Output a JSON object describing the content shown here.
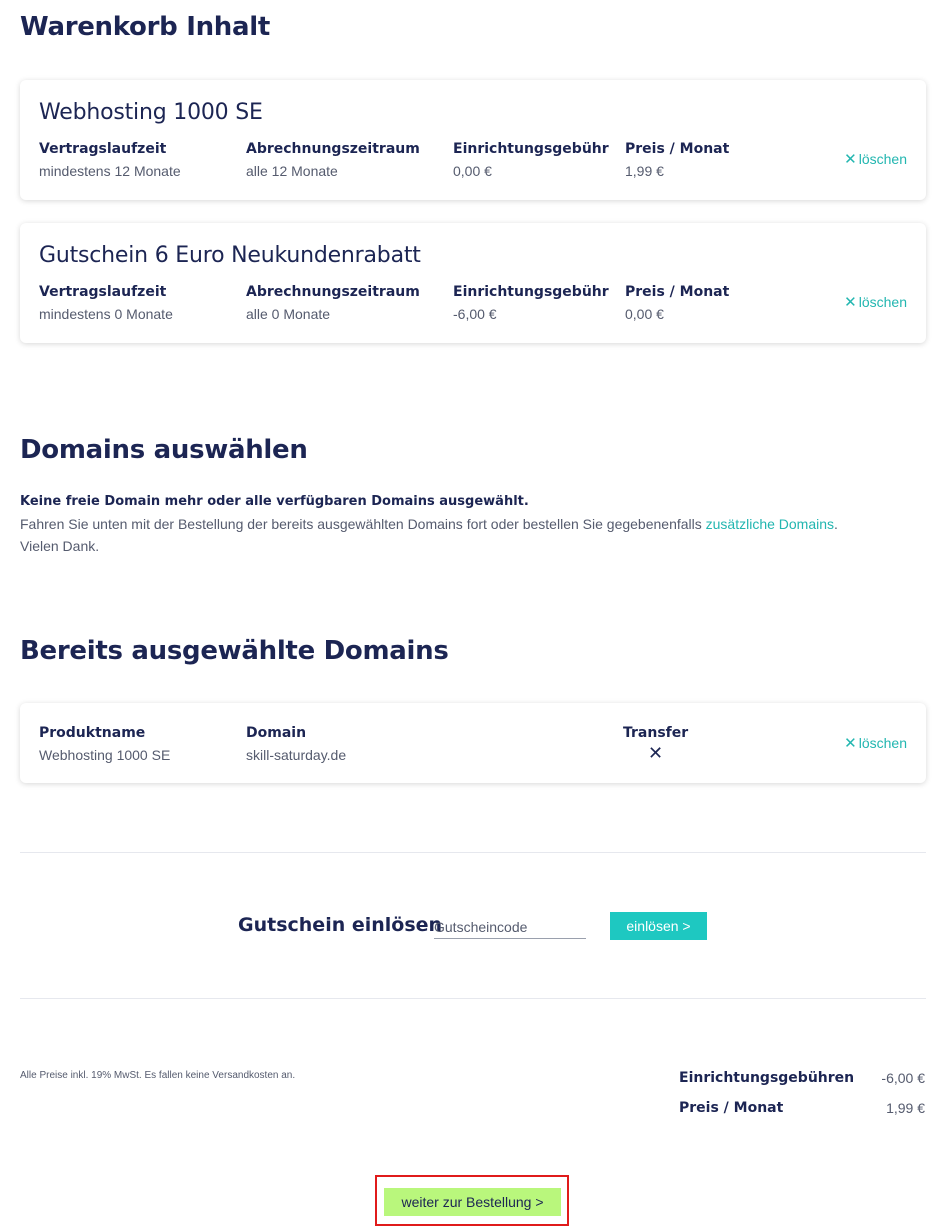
{
  "cart": {
    "title": "Warenkorb Inhalt",
    "items": [
      {
        "name": "Webhosting 1000 SE",
        "columns": [
          {
            "label": "Vertragslaufzeit",
            "value": "mindestens 12 Monate"
          },
          {
            "label": "Abrechnungszeitraum",
            "value": "alle 12 Monate"
          },
          {
            "label": "Einrichtungsgebühr",
            "value": "0,00 €"
          },
          {
            "label": "Preis / Monat",
            "value": "1,99 €"
          }
        ],
        "delete_label": "löschen"
      },
      {
        "name": "Gutschein 6 Euro Neukundenrabatt",
        "columns": [
          {
            "label": "Vertragslaufzeit",
            "value": "mindestens 0 Monate"
          },
          {
            "label": "Abrechnungszeitraum",
            "value": "alle 0 Monate"
          },
          {
            "label": "Einrichtungsgebühr",
            "value": "-6,00 €"
          },
          {
            "label": "Preis / Monat",
            "value": "0,00 €"
          }
        ],
        "delete_label": "löschen"
      }
    ]
  },
  "domains": {
    "title": "Domains auswählen",
    "notice_bold": "Keine freie Domain mehr oder alle verfügbaren Domains ausgewählt.",
    "notice_line2_prefix": "Fahren Sie unten mit der Bestellung der bereits ausgewählten Domains fort oder bestellen Sie gegebenenfalls ",
    "notice_link": "zusätzliche Domains",
    "notice_line2_suffix": ".",
    "notice_line3": "Vielen Dank."
  },
  "selected_domains": {
    "title": "Bereits ausgewählte Domains",
    "row": {
      "product_label": "Produktname",
      "product_value": "Webhosting 1000 SE",
      "domain_label": "Domain",
      "domain_value": "skill-saturday.de",
      "transfer_label": "Transfer",
      "transfer_value": "✕",
      "delete_label": "löschen"
    }
  },
  "coupon": {
    "label": "Gutschein einlösen",
    "placeholder": "Gutscheincode",
    "button": "einlösen >"
  },
  "summary": {
    "note": "Alle Preise inkl. 19% MwSt. Es fallen keine Versandkosten an.",
    "setup_label": "Einrichtungsgebühren",
    "setup_value": "-6,00 €",
    "monthly_label": "Preis / Monat",
    "monthly_value": "1,99 €"
  },
  "order_button": "weiter zur Bestellung >",
  "icons": {
    "delete": "close-icon",
    "transfer": "close-icon"
  },
  "colors": {
    "accent": "#22b6b0",
    "heading": "#1c2553",
    "order_button": "#b9f77c",
    "highlight_frame": "#e01b1b"
  }
}
